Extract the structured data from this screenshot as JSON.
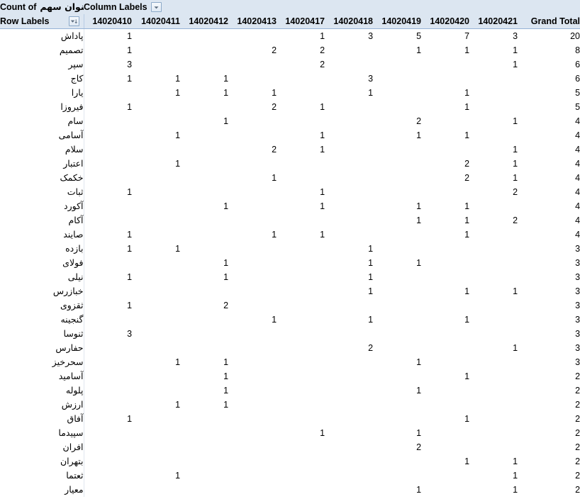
{
  "header": {
    "value_field_label": "Count of",
    "value_field_name": "عنوان سهم",
    "column_labels_label": "Column Labels",
    "row_labels_label": "Row Labels",
    "column_filter_icon": "chevron-down-icon",
    "row_filter_icon": "sort-filter-icon",
    "header_bg": "#dce6f1",
    "header_border": "#95b3d7"
  },
  "columns": [
    "14020410",
    "14020411",
    "14020412",
    "14020413",
    "14020417",
    "14020418",
    "14020419",
    "14020420",
    "14020421"
  ],
  "grand_total_label": "Grand Total",
  "rows": [
    {
      "label": "پاداش",
      "values": [
        "1",
        "",
        "",
        "",
        "1",
        "3",
        "5",
        "7",
        "3"
      ],
      "total": "20"
    },
    {
      "label": "تصمیم",
      "values": [
        "1",
        "",
        "",
        "2",
        "2",
        "",
        "1",
        "1",
        "1"
      ],
      "total": "8"
    },
    {
      "label": "سپر",
      "values": [
        "3",
        "",
        "",
        "",
        "2",
        "",
        "",
        "",
        "1"
      ],
      "total": "6"
    },
    {
      "label": "کاج",
      "values": [
        "1",
        "1",
        "1",
        "",
        "",
        "3",
        "",
        "",
        ""
      ],
      "total": "6"
    },
    {
      "label": "یارا",
      "values": [
        "",
        "1",
        "1",
        "1",
        "",
        "1",
        "",
        "1",
        ""
      ],
      "total": "5"
    },
    {
      "label": "فیروزا",
      "values": [
        "1",
        "",
        "",
        "2",
        "1",
        "",
        "",
        "1",
        ""
      ],
      "total": "5"
    },
    {
      "label": "سام",
      "values": [
        "",
        "",
        "1",
        "",
        "",
        "",
        "2",
        "",
        "1"
      ],
      "total": "4"
    },
    {
      "label": "آسامی",
      "values": [
        "",
        "1",
        "",
        "",
        "1",
        "",
        "1",
        "1",
        ""
      ],
      "total": "4"
    },
    {
      "label": "سلام",
      "values": [
        "",
        "",
        "",
        "2",
        "1",
        "",
        "",
        "",
        "1"
      ],
      "total": "4"
    },
    {
      "label": "اعتبار",
      "values": [
        "",
        "1",
        "",
        "",
        "",
        "",
        "",
        "2",
        "1"
      ],
      "total": "4"
    },
    {
      "label": "خکمک",
      "values": [
        "",
        "",
        "",
        "1",
        "",
        "",
        "",
        "2",
        "1"
      ],
      "total": "4"
    },
    {
      "label": "ثبات",
      "values": [
        "1",
        "",
        "",
        "",
        "1",
        "",
        "",
        "",
        "2"
      ],
      "total": "4"
    },
    {
      "label": "آکورد",
      "values": [
        "",
        "",
        "1",
        "",
        "1",
        "",
        "1",
        "1",
        ""
      ],
      "total": "4"
    },
    {
      "label": "آکام",
      "values": [
        "",
        "",
        "",
        "",
        "",
        "",
        "1",
        "1",
        "2"
      ],
      "total": "4"
    },
    {
      "label": "صایند",
      "values": [
        "1",
        "",
        "",
        "1",
        "1",
        "",
        "",
        "1",
        ""
      ],
      "total": "4"
    },
    {
      "label": "بازده",
      "values": [
        "1",
        "1",
        "",
        "",
        "",
        "1",
        "",
        "",
        ""
      ],
      "total": "3"
    },
    {
      "label": "فولای",
      "values": [
        "",
        "",
        "1",
        "",
        "",
        "1",
        "1",
        "",
        ""
      ],
      "total": "3"
    },
    {
      "label": "نیلی",
      "values": [
        "1",
        "",
        "1",
        "",
        "",
        "1",
        "",
        "",
        ""
      ],
      "total": "3"
    },
    {
      "label": "خبازرس",
      "values": [
        "",
        "",
        "",
        "",
        "",
        "1",
        "",
        "1",
        "1"
      ],
      "total": "3"
    },
    {
      "label": "ثقزوی",
      "values": [
        "1",
        "",
        "2",
        "",
        "",
        "",
        "",
        "",
        ""
      ],
      "total": "3"
    },
    {
      "label": "گنجینه",
      "values": [
        "",
        "",
        "",
        "1",
        "",
        "1",
        "",
        "1",
        ""
      ],
      "total": "3"
    },
    {
      "label": "ثنوسا",
      "values": [
        "3",
        "",
        "",
        "",
        "",
        "",
        "",
        "",
        ""
      ],
      "total": "3"
    },
    {
      "label": "حفارس",
      "values": [
        "",
        "",
        "",
        "",
        "",
        "2",
        "",
        "",
        "1"
      ],
      "total": "3"
    },
    {
      "label": "سحرخیز",
      "values": [
        "",
        "1",
        "1",
        "",
        "",
        "",
        "1",
        "",
        ""
      ],
      "total": "3"
    },
    {
      "label": "آسامید",
      "values": [
        "",
        "",
        "1",
        "",
        "",
        "",
        "",
        "1",
        ""
      ],
      "total": "2"
    },
    {
      "label": "پلوله",
      "values": [
        "",
        "",
        "1",
        "",
        "",
        "",
        "1",
        "",
        ""
      ],
      "total": "2"
    },
    {
      "label": "ارزش",
      "values": [
        "",
        "1",
        "1",
        "",
        "",
        "",
        "",
        "",
        ""
      ],
      "total": "2"
    },
    {
      "label": "آفاق",
      "values": [
        "1",
        "",
        "",
        "",
        "",
        "",
        "",
        "1",
        ""
      ],
      "total": "2"
    },
    {
      "label": "سپیدما",
      "values": [
        "",
        "",
        "",
        "",
        "1",
        "",
        "1",
        "",
        ""
      ],
      "total": "2"
    },
    {
      "label": "افران",
      "values": [
        "",
        "",
        "",
        "",
        "",
        "",
        "2",
        "",
        ""
      ],
      "total": "2"
    },
    {
      "label": "بتهران",
      "values": [
        "",
        "",
        "",
        "",
        "",
        "",
        "",
        "1",
        "1"
      ],
      "total": "2"
    },
    {
      "label": "ثعتما",
      "values": [
        "",
        "1",
        "",
        "",
        "",
        "",
        "",
        "",
        "1"
      ],
      "total": "2"
    },
    {
      "label": "معیار",
      "values": [
        "",
        "",
        "",
        "",
        "",
        "",
        "1",
        "",
        "1"
      ],
      "total": "2"
    }
  ]
}
